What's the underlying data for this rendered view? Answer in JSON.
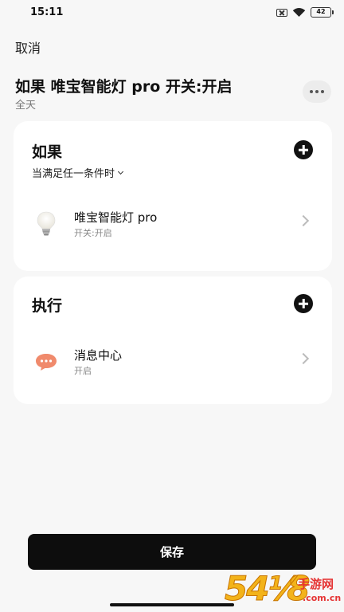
{
  "status_bar": {
    "time": "15:11",
    "battery": "42"
  },
  "header": {
    "cancel_label": "取消",
    "title": "如果 唯宝智能灯 pro 开关:开启",
    "subtitle": "全天"
  },
  "if_section": {
    "title": "如果",
    "condition_mode": "当满足任一条件时",
    "items": [
      {
        "name": "唯宝智能灯 pro",
        "detail": "开关:开启",
        "icon": "light-bulb-icon"
      }
    ]
  },
  "do_section": {
    "title": "执行",
    "items": [
      {
        "name": "消息中心",
        "detail": "开启",
        "icon": "message-bubble-icon"
      }
    ]
  },
  "save_label": "保存",
  "watermark": {
    "digits": "54⅟8",
    "text": "手游网",
    "domain": ".com.cn"
  },
  "colors": {
    "background": "#f7f7f7",
    "card": "#ffffff",
    "save_button": "#0d0d0d",
    "message_icon": "#f08a6c",
    "watermark_orange": "#f3b31a",
    "watermark_red": "#e53333"
  }
}
